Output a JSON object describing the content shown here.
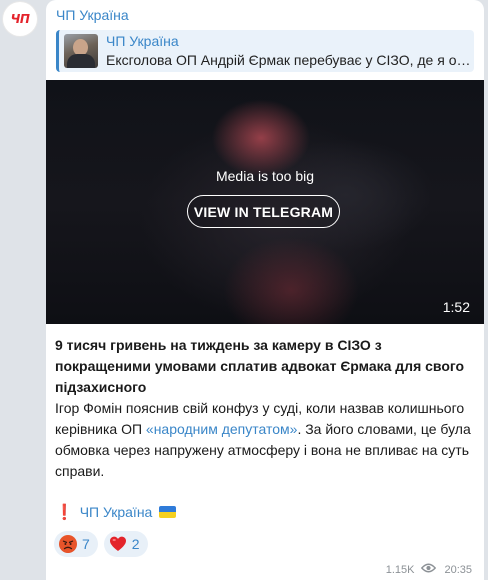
{
  "channel": {
    "avatar_text": "ЧП",
    "name": "ЧП Україна"
  },
  "reply": {
    "title": "ЧП Україна",
    "text": "Ексголова ОП Андрій Єрмак перебуває у СІЗО, де я ос..."
  },
  "media": {
    "message": "Media is too big",
    "button_label": "VIEW IN TELEGRAM",
    "duration": "1:52"
  },
  "post": {
    "headline": "9 тисяч гривень на тиждень за камеру в СІЗО з покращеними умовами сплатив адвокат Єрмака для свого підзахисного",
    "body_before": "Ігор Фомін пояснив свій конфуз у суді, коли назвав колишнього керівника ОП ",
    "body_link": "«народним депутатом»",
    "body_after": ". За його словами, це була обмовка через напружену атмосферу і вона не впливає на суть справи.",
    "signature_mark": "❗️",
    "signature": "ЧП Україна"
  },
  "reactions": [
    {
      "icon": "angry-face-icon",
      "count": "7"
    },
    {
      "icon": "heart-icon",
      "count": "2"
    }
  ],
  "meta": {
    "views": "1.15K",
    "time": "20:35"
  },
  "colors": {
    "link": "#3a86c8",
    "background": "#dfe3e8",
    "reaction_bg": "#e8f0f8"
  }
}
